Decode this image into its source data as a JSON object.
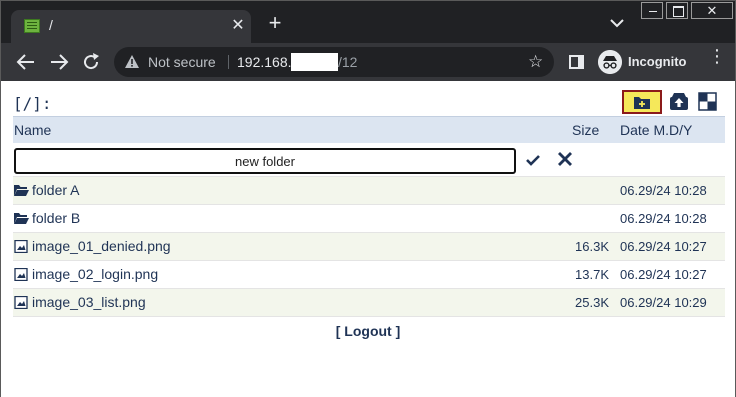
{
  "browser": {
    "tab_title": "/",
    "tab_close": "✕",
    "new_tab": "+",
    "window_close": "✕",
    "security_label": "Not secure",
    "url_host": "192.168.",
    "url_path": "/12",
    "bookmark_star": "☆",
    "profile_label": "Incognito",
    "menu": "⋮"
  },
  "explorer": {
    "path": "[/]:",
    "columns": {
      "name": "Name",
      "size": "Size",
      "date": "Date M.D/Y"
    },
    "new_folder_value": "new folder",
    "rows": [
      {
        "type": "folder",
        "name": "folder A",
        "size": "",
        "date": "06.29/24 10:28"
      },
      {
        "type": "folder",
        "name": "folder B",
        "size": "",
        "date": "06.29/24 10:28"
      },
      {
        "type": "image",
        "name": "image_01_denied.png",
        "size": "16.3K",
        "date": "06.29/24 10:27"
      },
      {
        "type": "image",
        "name": "image_02_login.png",
        "size": "13.7K",
        "date": "06.29/24 10:27"
      },
      {
        "type": "image",
        "name": "image_03_list.png",
        "size": "25.3K",
        "date": "06.29/24 10:29"
      }
    ],
    "logout": "[ Logout ]"
  },
  "colors": {
    "accent": "#1f3355",
    "header_bg": "#dce5f1",
    "row_alt_bg": "#f3f6ec",
    "highlight_button": "#f5e85a"
  }
}
